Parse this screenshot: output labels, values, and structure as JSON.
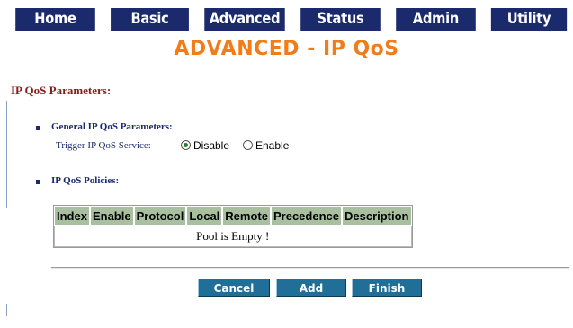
{
  "nav": {
    "items": [
      {
        "label": "Home"
      },
      {
        "label": "Basic"
      },
      {
        "label": "Advanced"
      },
      {
        "label": "Status"
      },
      {
        "label": "Admin"
      },
      {
        "label": "Utility"
      }
    ]
  },
  "page": {
    "title": "ADVANCED - IP QoS",
    "section_heading": "IP QoS Parameters:"
  },
  "general": {
    "heading": "General IP QoS Parameters:",
    "trigger_label": "Trigger IP QoS Service:",
    "options": [
      {
        "label": "Disable",
        "selected": true
      },
      {
        "label": "Enable",
        "selected": false
      }
    ]
  },
  "policies": {
    "heading": "IP QoS Policies:",
    "columns": [
      "Index",
      "Enable",
      "Protocol",
      "Local",
      "Remote",
      "Precedence",
      "Description"
    ],
    "empty_message": "Pool is Empty !"
  },
  "buttons": {
    "cancel": "Cancel",
    "add": "Add",
    "finish": "Finish"
  },
  "colors": {
    "nav_bg": "#1a2a6c",
    "title": "#f07c1a",
    "section_heading": "#8b1a1a",
    "table_header_bg": "#a8c0a0",
    "button_bg": "#1f6f98"
  }
}
